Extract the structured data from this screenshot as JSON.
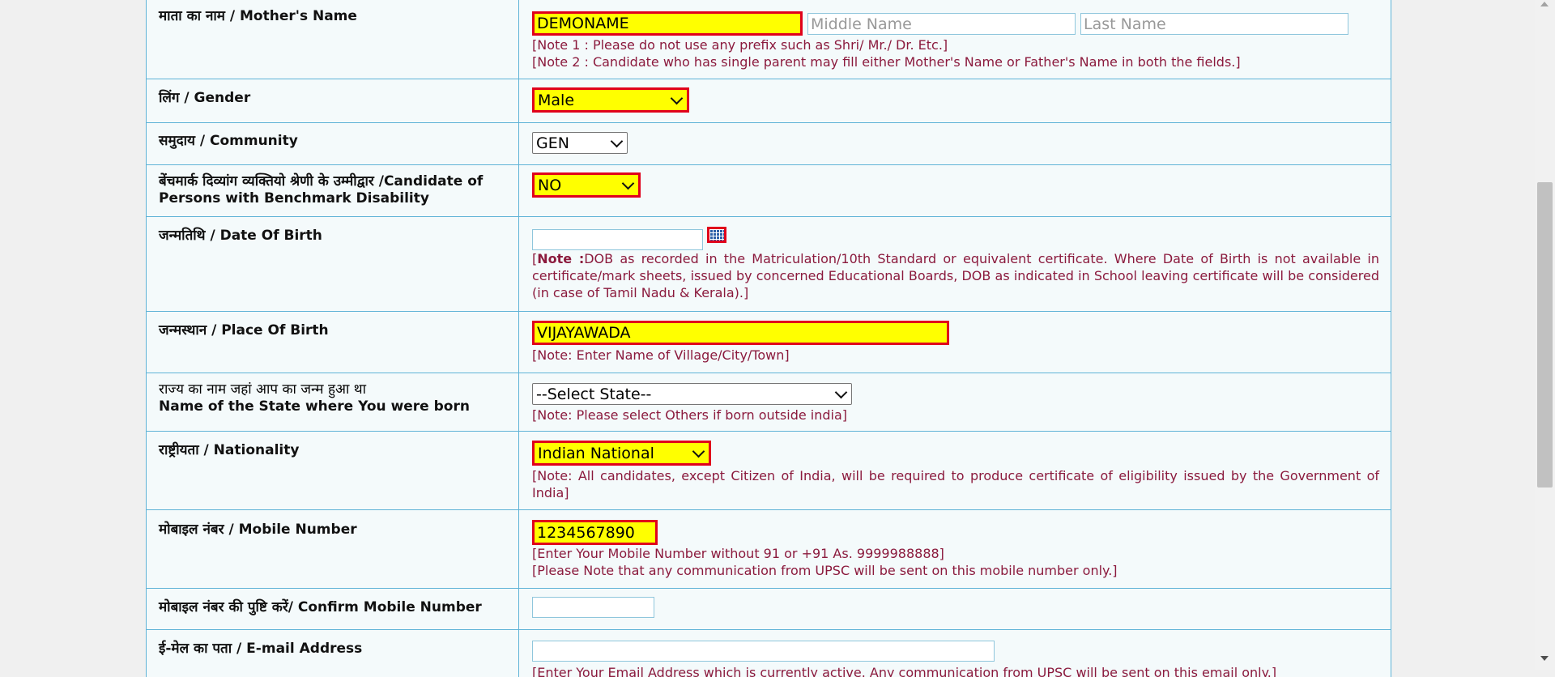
{
  "rows": {
    "mother_name": {
      "label": "माता का नाम / Mother's Name",
      "first_value": "DEMONAME",
      "middle_placeholder": "Middle Name",
      "last_placeholder": "Last Name",
      "note1": "[Note 1 : Please do not use any prefix such as Shri/ Mr./ Dr. Etc.]",
      "note2": "[Note 2 : Candidate who has single parent may fill either Mother's Name or Father's Name in both the fields.]"
    },
    "gender": {
      "label": "लिंग / Gender",
      "value": "Male"
    },
    "community": {
      "label": "समुदाय / Community",
      "value": "GEN"
    },
    "disability": {
      "label_line1": "बेंचमार्क दिव्यांग व्यक्तियो श्रेणी के उम्मीद्वार /Candidate of",
      "label_line2": "Persons with Benchmark Disability",
      "value": "NO"
    },
    "dob": {
      "label": "जन्मतिथि / Date Of Birth",
      "value": "",
      "note_open": "[",
      "note_bold": "Note :",
      "note_text": "DOB as recorded in the Matriculation/10th Standard or equivalent certificate. Where Date of Birth is not available in certificate/mark sheets, issued by concerned Educational Boards, DOB as indicated in School leaving certificate will be considered (in case of Tamil Nadu & Kerala).]"
    },
    "birth_place": {
      "label": "जन्मस्थान / Place Of Birth",
      "value": "VIJAYAWADA",
      "note": "[Note: Enter Name of Village/City/Town]"
    },
    "birth_state": {
      "label_line1": "राज्य का नाम जहां आप का जन्म हुआ था",
      "label_line2": "Name of the State where You were born",
      "value": "--Select State--",
      "note": "[Note: Please select Others if born outside india]"
    },
    "nationality": {
      "label": "राष्ट्रीयता / Nationality",
      "value": "Indian National",
      "note": "[Note: All candidates, except Citizen of India, will be required to produce certificate of eligibility issued by the Government of India]"
    },
    "mobile": {
      "label": "मोबाइल नंबर / Mobile Number",
      "value": "1234567890",
      "note1": "[Enter Your Mobile Number without 91 or +91 As. 9999988888]",
      "note2": "[Please Note that any communication from UPSC will be sent on this mobile number only.]"
    },
    "confirm_mobile": {
      "label": "मोबाइल नंबर की पुष्टि करें/ Confirm Mobile Number",
      "value": ""
    },
    "email": {
      "label": "ई-मेल का पता / E-mail Address",
      "value": "",
      "note": "[Enter Your Email Address which is currently active. Any communication from UPSC will be sent on this email only.]"
    }
  },
  "colors": {
    "highlight": "#ffff00",
    "error_border": "#e0001b",
    "note_text": "#8b1a3d",
    "grid_line": "#5fb3d7"
  }
}
